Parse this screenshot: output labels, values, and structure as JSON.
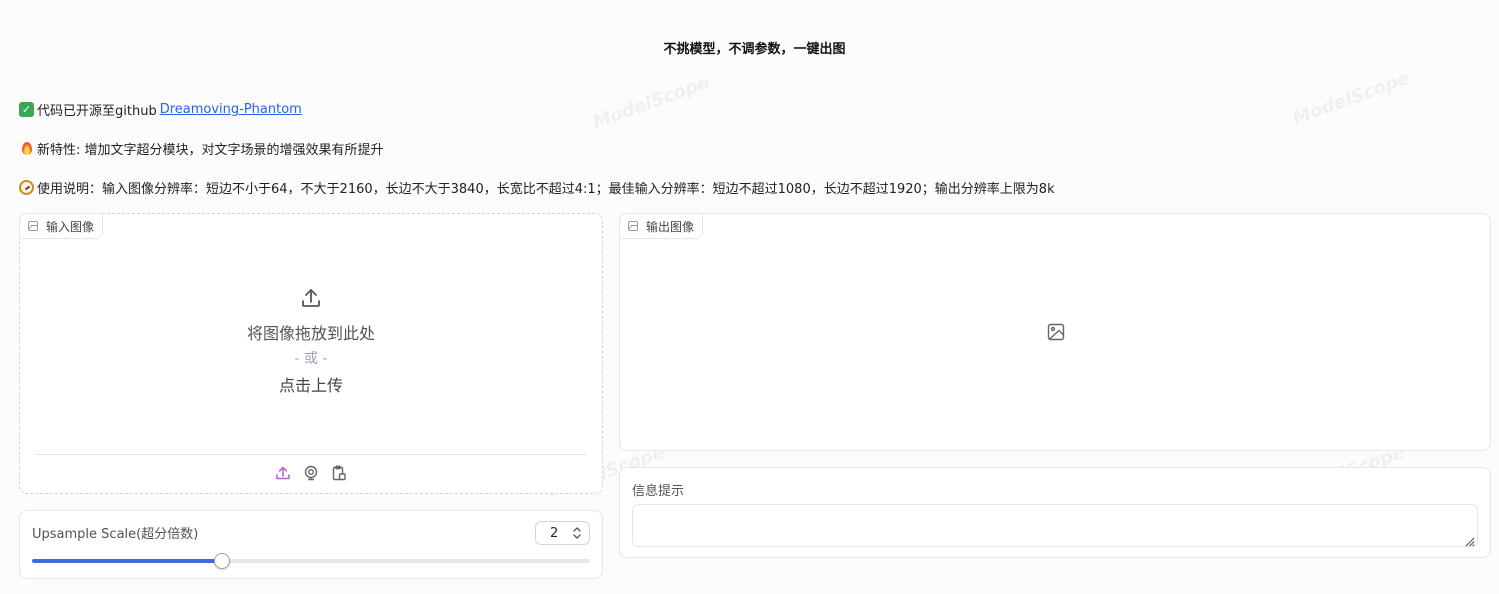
{
  "header": {
    "title": "不挑模型，不调参数，一键出图"
  },
  "notes": {
    "opensource_text": "代码已开源至github",
    "opensource_link": "Dreamoving-Phantom",
    "feature_text": "新特性: 增加文字超分模块，对文字场景的增强效果有所提升",
    "usage_text": "使用说明：输入图像分辨率：短边不小于64，不大于2160，长边不大于3840，长宽比不超过4:1；最佳输入分辨率：短边不超过1080，长边不超过1920；输出分辨率上限为8k"
  },
  "input_panel": {
    "label": "输入图像",
    "drop_text": "将图像拖放到此处",
    "or_text": "- 或 -",
    "click_text": "点击上传",
    "tools": [
      "upload-icon",
      "webcam-icon",
      "clipboard-icon"
    ]
  },
  "output_panel": {
    "label": "输出图像"
  },
  "slider": {
    "label": "Upsample Scale(超分倍数)",
    "value": "2",
    "fraction": 0.34
  },
  "info": {
    "label": "信息提示",
    "value": ""
  },
  "watermark": "ModelScope",
  "colors": {
    "accent": "#3b6ed8",
    "link": "#2563eb",
    "tool_icon": "#b45fcf"
  }
}
